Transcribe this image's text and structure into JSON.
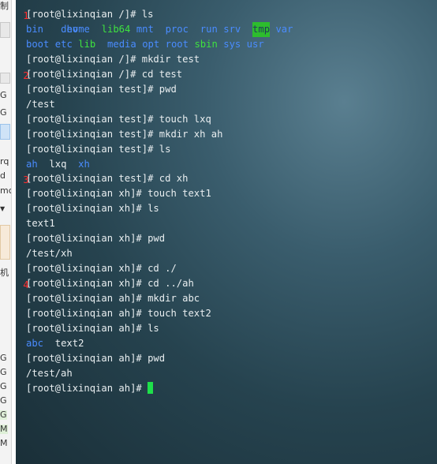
{
  "markers": [
    "1",
    "2",
    "3",
    "4"
  ],
  "left_strip": {
    "fragments": [
      "制",
      "G",
      "G",
      "rq",
      "d",
      "mc",
      "机",
      "G",
      "G",
      "G",
      "G",
      "G",
      "M",
      "M"
    ]
  },
  "terminal": {
    "lines": [
      {
        "kind": "cmd",
        "prompt": "[root@lixinqian /]# ",
        "command": "ls"
      },
      {
        "kind": "ls",
        "items": [
          {
            "name": "bin",
            "type": "dir"
          },
          {
            "name": "dev",
            "type": "dir"
          },
          {
            "name": "home",
            "type": "dir"
          },
          {
            "name": "lib64",
            "type": "exec"
          },
          {
            "name": "mnt",
            "type": "dir"
          },
          {
            "name": "proc",
            "type": "dir"
          },
          {
            "name": "run",
            "type": "dir"
          },
          {
            "name": "srv",
            "type": "dir"
          },
          {
            "name": "tmp",
            "type": "highlight"
          },
          {
            "name": "var",
            "type": "dir"
          }
        ]
      },
      {
        "kind": "ls",
        "items": [
          {
            "name": "boot",
            "type": "dir"
          },
          {
            "name": "etc",
            "type": "dir"
          },
          {
            "name": "lib",
            "type": "exec"
          },
          {
            "name": "media",
            "type": "dir"
          },
          {
            "name": "opt",
            "type": "dir"
          },
          {
            "name": "root",
            "type": "dir"
          },
          {
            "name": "sbin",
            "type": "exec"
          },
          {
            "name": "sys",
            "type": "dir"
          },
          {
            "name": "usr",
            "type": "dir"
          }
        ]
      },
      {
        "kind": "cmd",
        "prompt": "[root@lixinqian /]# ",
        "command": "mkdir test"
      },
      {
        "kind": "cmd",
        "prompt": "[root@lixinqian /]# ",
        "command": "cd test"
      },
      {
        "kind": "cmd",
        "prompt": "[root@lixinqian test]# ",
        "command": "pwd"
      },
      {
        "kind": "out",
        "text": "/test"
      },
      {
        "kind": "cmd",
        "prompt": "[root@lixinqian test]# ",
        "command": "touch lxq"
      },
      {
        "kind": "cmd",
        "prompt": "[root@lixinqian test]# ",
        "command": "mkdir xh ah"
      },
      {
        "kind": "cmd",
        "prompt": "[root@lixinqian test]# ",
        "command": "ls"
      },
      {
        "kind": "ls",
        "items": [
          {
            "name": "ah",
            "type": "dir"
          },
          {
            "name": "lxq",
            "type": "file"
          },
          {
            "name": "xh",
            "type": "dir"
          }
        ]
      },
      {
        "kind": "cmd",
        "prompt": "[root@lixinqian test]# ",
        "command": "cd xh"
      },
      {
        "kind": "cmd",
        "prompt": "[root@lixinqian xh]# ",
        "command": "touch text1"
      },
      {
        "kind": "cmd",
        "prompt": "[root@lixinqian xh]# ",
        "command": "ls"
      },
      {
        "kind": "out",
        "text": "text1"
      },
      {
        "kind": "cmd",
        "prompt": "[root@lixinqian xh]# ",
        "command": "pwd"
      },
      {
        "kind": "out",
        "text": "/test/xh"
      },
      {
        "kind": "cmd",
        "prompt": "[root@lixinqian xh]# ",
        "command": "cd ./"
      },
      {
        "kind": "cmd",
        "prompt": "[root@lixinqian xh]# ",
        "command": "cd ../ah"
      },
      {
        "kind": "cmd",
        "prompt": "[root@lixinqian ah]# ",
        "command": "mkdir abc"
      },
      {
        "kind": "cmd",
        "prompt": "[root@lixinqian ah]# ",
        "command": "touch text2"
      },
      {
        "kind": "cmd",
        "prompt": "[root@lixinqian ah]# ",
        "command": "ls"
      },
      {
        "kind": "ls",
        "items": [
          {
            "name": "abc",
            "type": "dir"
          },
          {
            "name": "text2",
            "type": "file"
          }
        ]
      },
      {
        "kind": "cmd",
        "prompt": "[root@lixinqian ah]# ",
        "command": "pwd"
      },
      {
        "kind": "out",
        "text": "/test/ah"
      },
      {
        "kind": "cmd",
        "prompt": "[root@lixinqian ah]# ",
        "command": "",
        "cursor": true
      }
    ]
  },
  "colors": {
    "dir": "#4a8cff",
    "exec": "#3fe23f",
    "highlight_bg": "#2dbd2d",
    "marker": "#ff2e2e",
    "cursor": "#1ee04a",
    "text": "#e9eef0"
  }
}
